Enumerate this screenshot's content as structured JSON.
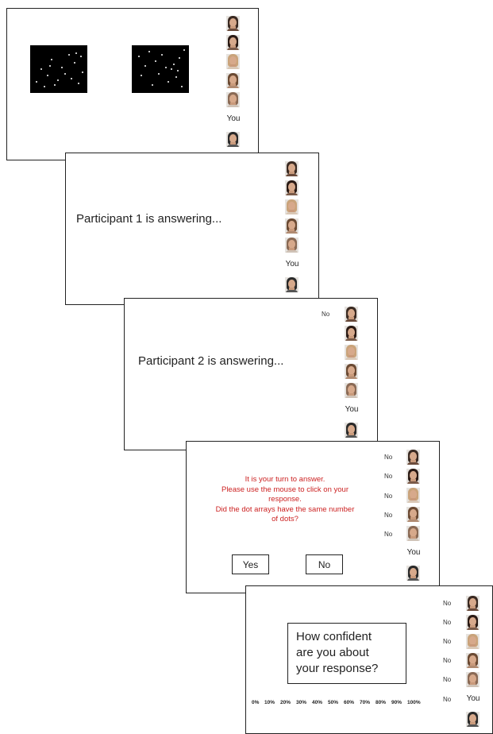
{
  "panels": {
    "p1": {},
    "p2": {
      "message": "Participant 1 is answering..."
    },
    "p3": {
      "message": "Participant 2 is answering..."
    },
    "p4": {
      "prompt_lines": [
        "It is your turn to answer.",
        "Please use the mouse to click on your",
        "response.",
        "Did the dot arrays have the same number",
        "of dots?"
      ],
      "yes_label": "Yes",
      "no_label": "No"
    },
    "p5": {
      "question_lines": [
        "How confident",
        "are you about",
        "your response?"
      ],
      "scale": [
        "0%",
        "10%",
        "20%",
        "30%",
        "40%",
        "50%",
        "60%",
        "70%",
        "80%",
        "90%",
        "100%"
      ]
    }
  },
  "you_label": "You",
  "no_response": "No",
  "participants": [
    {
      "icon": "participant-face-1-icon",
      "hair": "#3a2a22",
      "shirt": "#6a4a3a"
    },
    {
      "icon": "participant-face-2-icon",
      "hair": "#2a1a14",
      "shirt": "#7a5a48"
    },
    {
      "icon": "participant-face-3-icon",
      "hair": "#c9a37a",
      "shirt": "#d9c7b5"
    },
    {
      "icon": "participant-face-4-icon",
      "hair": "#6b4a33",
      "shirt": "#b08a70"
    },
    {
      "icon": "participant-face-5-icon",
      "hair": "#8a6a55",
      "shirt": "#cfc2b6"
    }
  ],
  "self": {
    "icon": "self-face-icon",
    "hair": "#2a2a2a",
    "shirt": "#555555"
  },
  "colors": {
    "prompt_text": "#cc2222",
    "dot_background": "#000000",
    "dot": "#ffffff"
  }
}
